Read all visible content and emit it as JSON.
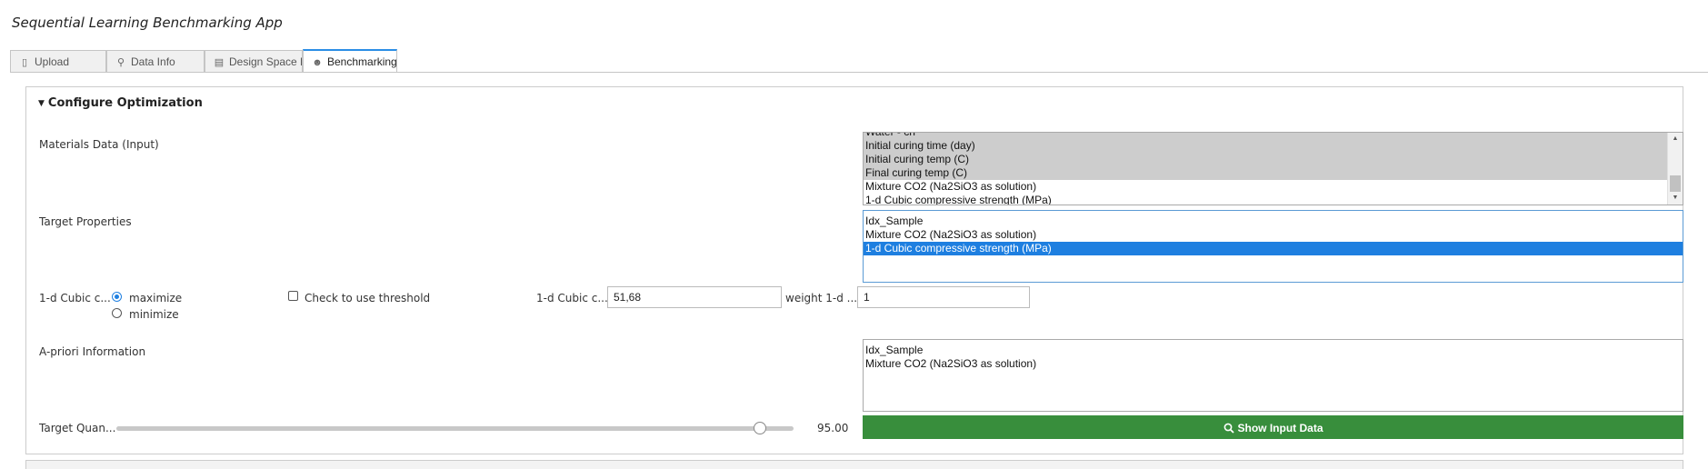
{
  "app": {
    "title": "Sequential Learning Benchmarking App"
  },
  "tabs": [
    {
      "label": "Upload",
      "icon": "upload-icon"
    },
    {
      "label": "Data Info",
      "icon": "search-icon"
    },
    {
      "label": "Design Space Ex",
      "icon": "chart-icon"
    },
    {
      "label": "Benchmarking",
      "icon": "robot-icon",
      "active": true
    }
  ],
  "config": {
    "section_title": "Configure Optimization",
    "materials_label": "Materials Data (Input)",
    "materials_options": [
      "Water - ch",
      "Initial curing time (day)",
      "Initial curing temp (C)",
      "Final curing temp (C)",
      "Mixture CO2 (Na2SiO3 as solution)",
      "1-d Cubic compressive strength (MPa)"
    ],
    "target_label": "Target Properties",
    "target_options": [
      "Idx_Sample",
      "Mixture CO2 (Na2SiO3 as solution)",
      "1-d Cubic compressive strength (MPa)"
    ],
    "target_row_label": "1-d Cubic c...",
    "maximize_label": "maximize",
    "minimize_label": "minimize",
    "threshold_label": "Check to use threshold",
    "threshold_field_label": "1-d Cubic c...",
    "threshold_value": "51,68",
    "weight_label": "weight 1-d ...",
    "weight_value": "1",
    "apriori_label": "A-priori Information",
    "apriori_options": [
      "Idx_Sample",
      "Mixture CO2 (Na2SiO3 as solution)"
    ],
    "quantile_label": "Target Quan...",
    "quantile_value": "95.00",
    "quantile_fraction": 0.95,
    "show_button_label": "Show Input Data"
  },
  "colors": {
    "accent": "#1e7fe0",
    "button": "#388e3c",
    "tab_active_border": "#2a8de5"
  }
}
